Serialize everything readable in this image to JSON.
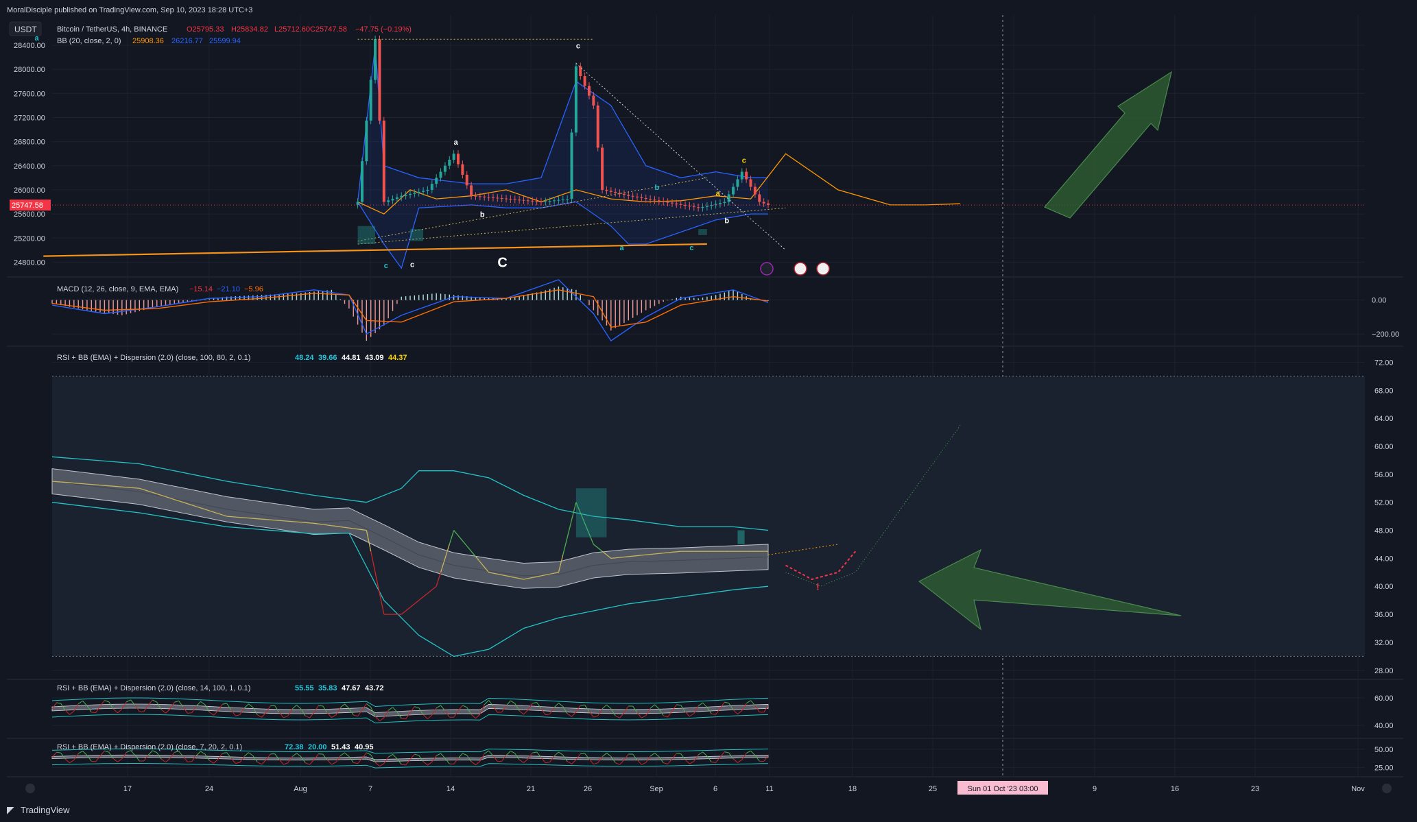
{
  "header": {
    "publisher": "MoralDisciple published on TradingView.com, Sep 10, 2023 18:28 UTC+3",
    "currency": "USDT",
    "symbol_line": "Bitcoin / TetherUS, 4h, BINANCE",
    "ohlc": {
      "o": "O25795.33",
      "h": "H25834.82",
      "l": "L25712.60",
      "c": "C25747.58",
      "chg": "−47.75 (−0.19%)"
    },
    "bb_label": "BB (20, close, 2, 0)",
    "bb_values": [
      "25908.36",
      "26216.77",
      "25599.94"
    ],
    "last_price": "25747.58"
  },
  "colors": {
    "background": "#131722",
    "grid": "#1e2230",
    "up": "#26a69a",
    "down": "#ef5350",
    "price": "#f23645",
    "bb_basis": "#ff9800",
    "bb_band": "#2962ff",
    "macd": "#2962ff",
    "signal": "#ff6d00",
    "support": "#f7931a",
    "rsi_band": "#22c3c6",
    "arrow": "#2e5e32",
    "crosshair_label": "#f8bbd0"
  },
  "chart_data": [
    {
      "type": "line",
      "panel": "price",
      "title": "Bitcoin / TetherUS, 4h, BINANCE",
      "x": [
        "Jul 17",
        "Jul 24",
        "Aug 1",
        "Aug 7",
        "Aug 14",
        "Aug 21",
        "Aug 26",
        "Sep 1",
        "Sep 6",
        "Sep 11"
      ],
      "y_ticks": [
        24800,
        25200,
        25600,
        26000,
        26400,
        26800,
        27200,
        27600,
        28000,
        28400
      ],
      "ylim": [
        24600,
        28900
      ],
      "series": [
        {
          "name": "BB (20, close, 2, 0)",
          "values": [
            [
              35,
              25800
            ],
            [
              38,
              25600
            ],
            [
              41,
              26000
            ],
            [
              44,
              25850
            ],
            [
              48,
              25900
            ],
            [
              52,
              26000
            ],
            [
              56,
              25800
            ],
            [
              60,
              26000
            ],
            [
              64,
              25850
            ],
            [
              68,
              25800
            ],
            [
              72,
              25820
            ],
            [
              76,
              25900
            ],
            [
              80,
              25850
            ],
            [
              84,
              26600
            ],
            [
              90,
              26000
            ],
            [
              96,
              25750
            ],
            [
              100,
              25750
            ],
            [
              104,
              25770
            ]
          ]
        },
        {
          "name": "",
          "values": [
            [
              35,
              25800
            ],
            [
              37,
              28500
            ],
            [
              38,
              25800
            ],
            [
              40,
              25900
            ],
            [
              43,
              26000
            ],
            [
              46,
              26600
            ],
            [
              48,
              25900
            ],
            [
              52,
              25850
            ],
            [
              56,
              25800
            ],
            [
              59,
              25850
            ],
            [
              60,
              28050
            ],
            [
              62,
              27400
            ],
            [
              63,
              26000
            ],
            [
              66,
              25900
            ],
            [
              70,
              25800
            ],
            [
              74,
              25700
            ],
            [
              77,
              25800
            ],
            [
              79,
              26300
            ],
            [
              81,
              25800
            ],
            [
              82,
              25750
            ]
          ]
        },
        {
          "name": "",
          "values": [
            [
              35,
              25800
            ],
            [
              37,
              28400
            ],
            [
              38,
              26400
            ],
            [
              42,
              26200
            ],
            [
              48,
              26100
            ],
            [
              52,
              26100
            ],
            [
              56,
              26200
            ],
            [
              60,
              27800
            ],
            [
              64,
              27400
            ],
            [
              68,
              26400
            ],
            [
              72,
              26200
            ],
            [
              76,
              26300
            ],
            [
              80,
              26200
            ],
            [
              82,
              26200
            ]
          ]
        },
        {
          "name": "",
          "values": [
            [
              35,
              25800
            ],
            [
              38,
              25100
            ],
            [
              40,
              24700
            ],
            [
              42,
              25700
            ],
            [
              48,
              25750
            ],
            [
              52,
              25700
            ],
            [
              56,
              25700
            ],
            [
              60,
              25800
            ],
            [
              64,
              25400
            ],
            [
              66,
              25100
            ],
            [
              68,
              25100
            ],
            [
              72,
              25300
            ],
            [
              76,
              25500
            ],
            [
              80,
              25600
            ],
            [
              82,
              25600
            ]
          ]
        }
      ],
      "support_line": [
        [
          -1,
          24900
        ],
        [
          75,
          25100
        ]
      ],
      "upper_channel": [
        [
          35,
          25150
        ],
        [
          75,
          26200
        ]
      ],
      "lower_channel": [
        [
          35,
          25100
        ],
        [
          84,
          25700
        ]
      ],
      "downtrend": [
        [
          60,
          28100
        ],
        [
          84,
          25000
        ]
      ],
      "resistance_dotted": [
        [
          35,
          28500
        ],
        [
          62,
          28500
        ]
      ],
      "wave_labels": [
        {
          "text": "a",
          "color": "#22c3c6",
          "x": -2,
          "y": 28480
        },
        {
          "text": "a",
          "color": "#ffffff",
          "x": 46,
          "y": 26750
        },
        {
          "text": "b",
          "color": "#ffffff",
          "x": 49,
          "y": 25550
        },
        {
          "text": "c",
          "color": "#22c3c6",
          "x": 38,
          "y": 24700
        },
        {
          "text": "c",
          "color": "#ffffff",
          "x": 41,
          "y": 24720
        },
        {
          "text": "c",
          "color": "#ffffff",
          "x": 60,
          "y": 28350
        },
        {
          "text": "C",
          "color": "#ffffff",
          "x": 51,
          "y": 24720
        },
        {
          "text": "a",
          "color": "#22c3c6",
          "x": 65,
          "y": 25000
        },
        {
          "text": "b",
          "color": "#22c3c6",
          "x": 69,
          "y": 26000
        },
        {
          "text": "c",
          "color": "#22c3c6",
          "x": 73,
          "y": 25000
        },
        {
          "text": "a",
          "color": "#ffd600",
          "x": 76,
          "y": 25900
        },
        {
          "text": "b",
          "color": "#ffffff",
          "x": 77,
          "y": 25450
        },
        {
          "text": "c",
          "color": "#ffd600",
          "x": 79,
          "y": 26450
        }
      ]
    },
    {
      "type": "line",
      "panel": "macd",
      "title": "MACD (12, 26, close, 9, EMA, EMA)",
      "values_shown": [
        "−15.14",
        "−21.10",
        "−5.96"
      ],
      "y_ticks": [
        0,
        -200
      ],
      "ylim": [
        -260,
        120
      ],
      "histogram": [
        [
          0,
          -20
        ],
        [
          4,
          -60
        ],
        [
          8,
          -90
        ],
        [
          12,
          -40
        ],
        [
          16,
          -10
        ],
        [
          20,
          20
        ],
        [
          24,
          30
        ],
        [
          28,
          40
        ],
        [
          32,
          60
        ],
        [
          34,
          -50
        ],
        [
          36,
          -240
        ],
        [
          38,
          -150
        ],
        [
          40,
          20
        ],
        [
          44,
          40
        ],
        [
          48,
          20
        ],
        [
          52,
          10
        ],
        [
          56,
          50
        ],
        [
          58,
          80
        ],
        [
          60,
          60
        ],
        [
          62,
          -60
        ],
        [
          64,
          -180
        ],
        [
          66,
          -120
        ],
        [
          68,
          -60
        ],
        [
          70,
          -10
        ],
        [
          72,
          20
        ],
        [
          74,
          10
        ],
        [
          76,
          30
        ],
        [
          78,
          60
        ],
        [
          80,
          10
        ],
        [
          82,
          -5
        ]
      ],
      "series": [
        {
          "name": "MACD",
          "values": [
            [
              0,
              -30
            ],
            [
              6,
              -80
            ],
            [
              12,
              -40
            ],
            [
              18,
              10
            ],
            [
              24,
              20
            ],
            [
              30,
              60
            ],
            [
              34,
              30
            ],
            [
              36,
              -200
            ],
            [
              40,
              -90
            ],
            [
              46,
              20
            ],
            [
              52,
              10
            ],
            [
              58,
              120
            ],
            [
              62,
              -80
            ],
            [
              64,
              -240
            ],
            [
              68,
              -100
            ],
            [
              72,
              10
            ],
            [
              78,
              60
            ],
            [
              82,
              -15
            ]
          ]
        },
        {
          "name": "Signal",
          "values": [
            [
              0,
              -20
            ],
            [
              6,
              -60
            ],
            [
              12,
              -50
            ],
            [
              18,
              -10
            ],
            [
              24,
              10
            ],
            [
              30,
              40
            ],
            [
              34,
              30
            ],
            [
              36,
              -120
            ],
            [
              40,
              -130
            ],
            [
              46,
              -10
            ],
            [
              52,
              10
            ],
            [
              58,
              60
            ],
            [
              62,
              20
            ],
            [
              64,
              -160
            ],
            [
              68,
              -130
            ],
            [
              72,
              -30
            ],
            [
              78,
              20
            ],
            [
              82,
              -5
            ]
          ]
        }
      ]
    },
    {
      "type": "line",
      "panel": "rsi_main",
      "title": "RSI + BB (EMA) + Dispersion (2.0) (close, 100, 80, 2, 0.1)",
      "values_shown": [
        "48.24",
        "39.66",
        "44.81",
        "43.09",
        "44.37"
      ],
      "y_ticks": [
        28,
        32,
        36,
        40,
        44,
        48,
        52,
        56,
        60,
        64,
        68,
        72
      ],
      "ylim": [
        27,
        74
      ],
      "levels": [
        70,
        30
      ],
      "series": [
        {
          "name": "",
          "values": [
            [
              0,
              55
            ],
            [
              10,
              54
            ],
            [
              20,
              50
            ],
            [
              30,
              49
            ],
            [
              36,
              48
            ],
            [
              38,
              36
            ],
            [
              40,
              36
            ],
            [
              44,
              40
            ],
            [
              46,
              48
            ],
            [
              50,
              42
            ],
            [
              54,
              41
            ],
            [
              58,
              42
            ],
            [
              60,
              52
            ],
            [
              62,
              46
            ],
            [
              64,
              44
            ],
            [
              72,
              45
            ],
            [
              78,
              45
            ],
            [
              82,
              45
            ]
          ]
        },
        {
          "name": "",
          "values": [
            [
              0,
              55
            ],
            [
              10,
              53.5
            ],
            [
              20,
              51
            ],
            [
              30,
              49.2
            ],
            [
              34,
              49.4
            ],
            [
              38,
              47
            ],
            [
              42,
              44.5
            ],
            [
              46,
              43
            ],
            [
              50,
              42.2
            ],
            [
              54,
              41.5
            ],
            [
              58,
              41.7
            ],
            [
              62,
              43
            ],
            [
              66,
              43.5
            ],
            [
              72,
              43.7
            ],
            [
              78,
              44
            ],
            [
              82,
              44.2
            ]
          ]
        },
        {
          "name": "",
          "values": [
            [
              0,
              58.5
            ],
            [
              10,
              57.5
            ],
            [
              20,
              55
            ],
            [
              30,
              53
            ],
            [
              36,
              52
            ],
            [
              40,
              54
            ],
            [
              42,
              56.5
            ],
            [
              46,
              56.5
            ],
            [
              50,
              55.5
            ],
            [
              54,
              53
            ],
            [
              58,
              51
            ],
            [
              62,
              50
            ],
            [
              66,
              49.5
            ],
            [
              72,
              48.5
            ],
            [
              78,
              48.5
            ],
            [
              82,
              48
            ]
          ]
        },
        {
          "name": "",
          "values": [
            [
              0,
              52
            ],
            [
              10,
              50.5
            ],
            [
              20,
              48.5
            ],
            [
              30,
              47.5
            ],
            [
              34,
              47.6
            ],
            [
              38,
              38
            ],
            [
              42,
              33
            ],
            [
              46,
              30
            ],
            [
              50,
              31
            ],
            [
              54,
              34
            ],
            [
              58,
              35.5
            ],
            [
              62,
              36.5
            ],
            [
              66,
              37.5
            ],
            [
              72,
              38.5
            ],
            [
              78,
              39.5
            ],
            [
              82,
              40
            ]
          ]
        }
      ],
      "projection": [
        [
          82,
          44.5
        ],
        [
          90,
          46
        ]
      ],
      "projected_curve_red": [
        [
          84,
          43
        ],
        [
          87,
          41
        ],
        [
          90,
          42
        ],
        [
          92,
          45
        ]
      ],
      "projected_curve_dotted": [
        [
          84,
          42
        ],
        [
          88,
          40
        ],
        [
          92,
          42
        ],
        [
          100,
          56
        ],
        [
          104,
          63
        ]
      ]
    },
    {
      "type": "line",
      "panel": "rsi_14",
      "title": "RSI + BB (EMA) + Dispersion (2.0) (close, 14, 100, 1, 0.1)",
      "values_shown": [
        "55.55",
        "35.83",
        "47.67",
        "43.72"
      ],
      "y_ticks": [
        40,
        60
      ],
      "ylim": [
        32,
        72
      ]
    },
    {
      "type": "line",
      "panel": "rsi_7",
      "title": "RSI + BB (EMA) + Dispersion (2.0) (close, 7, 20, 2, 0.1)",
      "values_shown": [
        "72.38",
        "20.00",
        "51.43",
        "40.95"
      ],
      "y_ticks": [
        25,
        50
      ],
      "ylim": [
        15,
        62
      ]
    }
  ],
  "time_axis": {
    "labels": [
      "17",
      "24",
      "Aug",
      "7",
      "14",
      "21",
      "26",
      "Sep",
      "6",
      "11",
      "18",
      "25",
      "9",
      "16",
      "23",
      "Nov"
    ],
    "crosshair": "Sun 01 Oct '23   03:00"
  },
  "footer": {
    "brand": "TradingView"
  }
}
